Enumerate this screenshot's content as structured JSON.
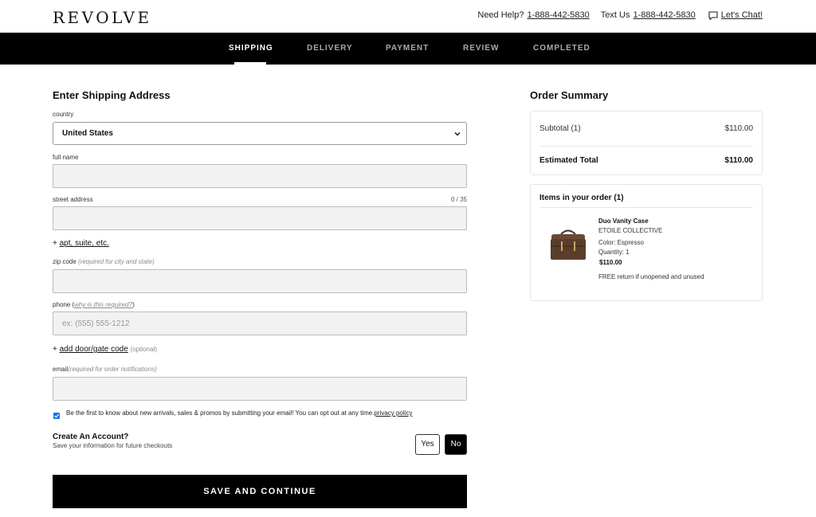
{
  "header": {
    "logo": "REVOLVE",
    "help_label": "Need Help?",
    "help_phone": "1-888-442-5830",
    "text_label": "Text Us",
    "text_phone": "1-888-442-5830",
    "chat_label": "Let's Chat!"
  },
  "steps": [
    "SHIPPING",
    "DELIVERY",
    "PAYMENT",
    "REVIEW",
    "COMPLETED"
  ],
  "form": {
    "title": "Enter Shipping Address",
    "country_label": "country",
    "country_value": "United States",
    "full_name_label": "full name",
    "street_label": "street address",
    "street_counter": "0 / 35",
    "apt_prefix": "+",
    "apt_link": "apt, suite, etc.",
    "zip_label": "zip code",
    "zip_hint": "(required for city and state)",
    "phone_label": "phone (",
    "phone_link": "why is this required?",
    "phone_label_end": ")",
    "phone_placeholder": "ex: (555) 555-1212",
    "door_prefix": "+",
    "door_link": "add door/gate code",
    "door_optional": "(optional)",
    "email_label": "email",
    "email_hint": "(required for order notifications)",
    "promo_text": "Be the first to know about new arrivals, sales & promos by submitting your email! You can opt out at any time.",
    "promo_link": "privacy policy",
    "account_title": "Create An Account?",
    "account_sub": "Save your information for future checkouts",
    "yes_label": "Yes",
    "no_label": "No",
    "save_label": "SAVE AND CONTINUE"
  },
  "summary": {
    "title": "Order Summary",
    "subtotal_label": "Subtotal (1)",
    "subtotal_value": "$110.00",
    "total_label": "Estimated Total",
    "total_value": "$110.00",
    "items_title": "Items in your order (1)",
    "product": {
      "name": "Duo Vanity Case",
      "brand": "ETOILE COLLECTIVE",
      "color": "Color:  Espresso",
      "quantity": "Quantity:  1",
      "price": "$110.00",
      "return_note": "FREE return if unopened and unused"
    }
  },
  "colors": {
    "accent_black": "#000000",
    "checkbox_blue": "#1a73e8",
    "product_brown": "#5a3e2b"
  }
}
